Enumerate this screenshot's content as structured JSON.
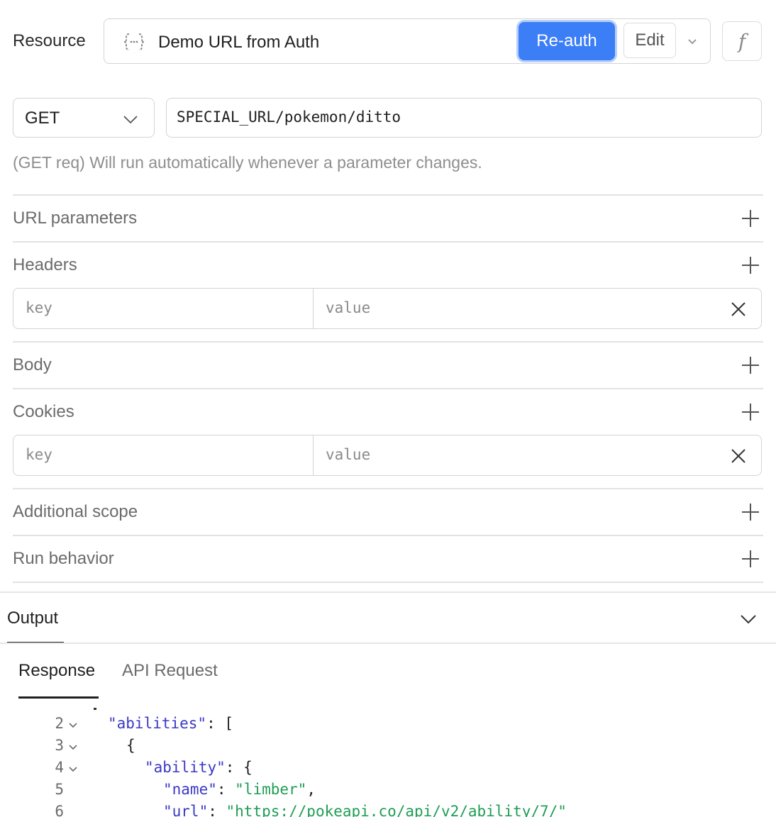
{
  "resource": {
    "label": "Resource",
    "name": "Demo URL from Auth",
    "reauth_label": "Re-auth",
    "edit_label": "Edit",
    "fx_label": "f",
    "accent": "#3b7ef6"
  },
  "request": {
    "method": "GET",
    "url": "SPECIAL_URL/pokemon/ditto",
    "hint": "(GET req) Will run automatically whenever a parameter changes."
  },
  "sections": {
    "url_params": "URL parameters",
    "headers": "Headers",
    "body": "Body",
    "cookies": "Cookies",
    "additional_scope": "Additional scope",
    "run_behavior": "Run behavior"
  },
  "kv": {
    "key_placeholder": "key",
    "value_placeholder": "value"
  },
  "output": {
    "title": "Output",
    "tabs": [
      "Response",
      "API Request"
    ]
  },
  "code": {
    "lines": [
      {
        "n": "2",
        "folded": true,
        "indent": 0,
        "parts": [
          [
            "k",
            "\"abilities\""
          ],
          [
            "p",
            ": ["
          ]
        ]
      },
      {
        "n": "3",
        "folded": true,
        "indent": 1,
        "parts": [
          [
            "p",
            "{"
          ]
        ]
      },
      {
        "n": "4",
        "folded": true,
        "indent": 2,
        "parts": [
          [
            "k",
            "\"ability\""
          ],
          [
            "p",
            ": {"
          ]
        ]
      },
      {
        "n": "5",
        "folded": false,
        "indent": 3,
        "parts": [
          [
            "k",
            "\"name\""
          ],
          [
            "p",
            ": "
          ],
          [
            "s",
            "\"limber\""
          ],
          [
            "p",
            ","
          ]
        ]
      },
      {
        "n": "6",
        "folded": false,
        "indent": 3,
        "parts": [
          [
            "k",
            "\"url\""
          ],
          [
            "p",
            ": "
          ],
          [
            "s",
            "\"https://pokeapi.co/api/v2/ability/7/\""
          ]
        ]
      }
    ]
  }
}
